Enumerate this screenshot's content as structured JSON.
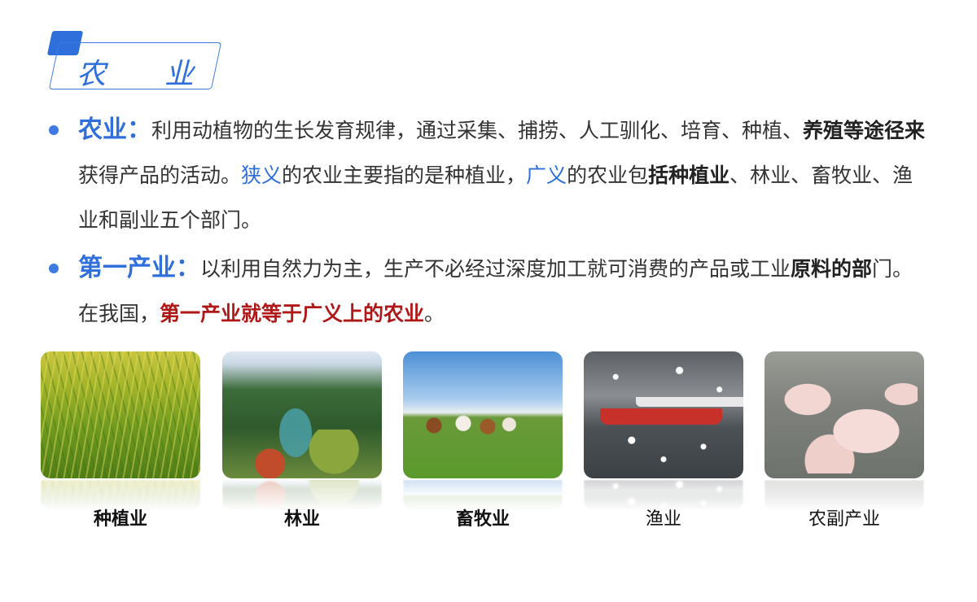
{
  "title": {
    "char1": "农",
    "char2": "业"
  },
  "section1": {
    "term": "农业：",
    "text_a": "利用动植物的生长发育规律，通过采集、捕捞、人工驯化、培育、种植、",
    "strong_a": "养殖等途径来",
    "text_b": "获得产品的活动。",
    "narrow": "狭义",
    "text_c": "的农业主要指的是种植业，",
    "broad": "广义",
    "text_d": "的农业包",
    "strong_b": "括种植业",
    "text_e": "、林业、畜牧业、渔业和副业五个部门。"
  },
  "section2": {
    "term": "第一产业：",
    "text_a": "以利用自然力为主，生产不必经过深度加工就可消费的产品或工业",
    "strong_a": "原料的部",
    "text_b": "门。在我国，",
    "highlight": "第一产业就等于广义上的农业",
    "text_c": "。"
  },
  "gallery": [
    {
      "caption": "种植业"
    },
    {
      "caption": "林业"
    },
    {
      "caption": "畜牧业"
    },
    {
      "caption": "渔业"
    },
    {
      "caption": "农副产业"
    }
  ],
  "colors": {
    "accent": "#2f6fdc",
    "highlight_red": "#b01818"
  }
}
